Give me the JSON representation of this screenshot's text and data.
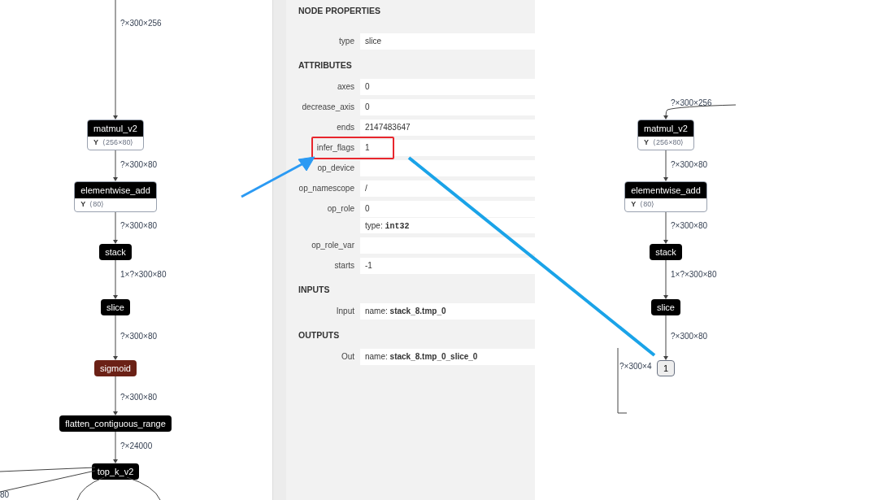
{
  "left_graph": {
    "items": [
      {
        "kind": "edge",
        "label": "?×300×256"
      },
      {
        "kind": "op",
        "title": "matmul_v2",
        "attribute": {
          "name": "Y",
          "value": "⟨256×80⟩"
        }
      },
      {
        "kind": "edge",
        "label": "?×300×80"
      },
      {
        "kind": "op",
        "title": "elementwise_add",
        "attribute": {
          "name": "Y",
          "value": "⟨80⟩"
        }
      },
      {
        "kind": "edge",
        "label": "?×300×80"
      },
      {
        "kind": "op",
        "title": "stack"
      },
      {
        "kind": "edge",
        "label": "1×?×300×80"
      },
      {
        "kind": "op",
        "title": "slice"
      },
      {
        "kind": "edge",
        "label": "?×300×80"
      },
      {
        "kind": "activation",
        "title": "sigmoid"
      },
      {
        "kind": "edge",
        "label": "?×300×80"
      },
      {
        "kind": "op",
        "title": "flatten_contiguous_range"
      },
      {
        "kind": "edge",
        "label": "?×24000"
      },
      {
        "kind": "op",
        "title": "top_k_v2"
      }
    ],
    "side_label": "80"
  },
  "properties": {
    "sections": [
      {
        "title": "NODE PROPERTIES",
        "rows": [
          {
            "label": "type",
            "value": "slice",
            "highlighted": false
          }
        ]
      },
      {
        "title": "ATTRIBUTES",
        "rows": [
          {
            "label": "axes",
            "value": "0",
            "highlighted": false
          },
          {
            "label": "decrease_axis",
            "value": "0",
            "highlighted": false
          },
          {
            "label": "ends",
            "value": "2147483647",
            "highlighted": false
          },
          {
            "label": "infer_flags",
            "value": "1",
            "highlighted": true
          },
          {
            "label": "op_device",
            "value": "",
            "highlighted": false
          },
          {
            "label": "op_namescope",
            "value": "/",
            "highlighted": false
          },
          {
            "label": "op_role",
            "value": "0",
            "detail": "type: **int32**",
            "highlighted": false
          },
          {
            "label": "op_role_var",
            "value": "",
            "highlighted": false
          },
          {
            "label": "starts",
            "value": "-1",
            "highlighted": false
          }
        ]
      },
      {
        "title": "INPUTS",
        "rows": [
          {
            "label": "Input",
            "value": "name: **stack_8.tmp_0**",
            "highlighted": false
          }
        ]
      },
      {
        "title": "OUTPUTS",
        "rows": [
          {
            "label": "Out",
            "value": "name: **stack_8.tmp_0_slice_0**",
            "highlighted": false
          }
        ]
      }
    ]
  },
  "right_graph": {
    "items": [
      {
        "kind": "edge",
        "label": "?×300×256"
      },
      {
        "kind": "op",
        "title": "matmul_v2",
        "attribute": {
          "name": "Y",
          "value": "⟨256×80⟩"
        }
      },
      {
        "kind": "edge",
        "label": "?×300×80"
      },
      {
        "kind": "op",
        "title": "elementwise_add",
        "attribute": {
          "name": "Y",
          "value": "⟨80⟩"
        }
      },
      {
        "kind": "edge",
        "label": "?×300×80"
      },
      {
        "kind": "op",
        "title": "stack"
      },
      {
        "kind": "edge",
        "label": "1×?×300×80"
      },
      {
        "kind": "op",
        "title": "slice"
      },
      {
        "kind": "edge",
        "label": "?×300×80"
      },
      {
        "kind": "constant",
        "title": "1"
      }
    ],
    "side_label": "?×300×4"
  }
}
